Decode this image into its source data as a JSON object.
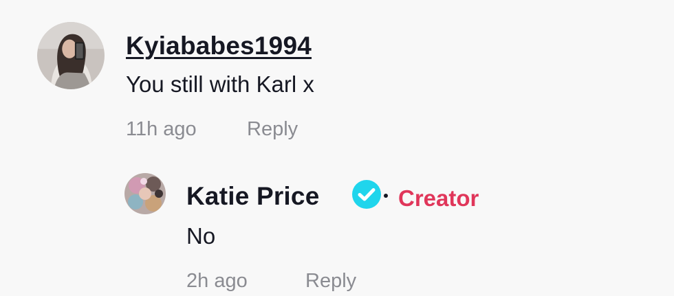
{
  "comments": [
    {
      "username": "Kyiababes1994",
      "text": "You still with Karl x",
      "time": "11h ago",
      "reply_label": "Reply"
    }
  ],
  "reply": {
    "username": "Katie Price",
    "verified": true,
    "badge": "Creator",
    "badge_color": "#e0365a",
    "verified_color": "#20d5ec",
    "text": "No",
    "time": "2h ago",
    "reply_label": "Reply"
  }
}
